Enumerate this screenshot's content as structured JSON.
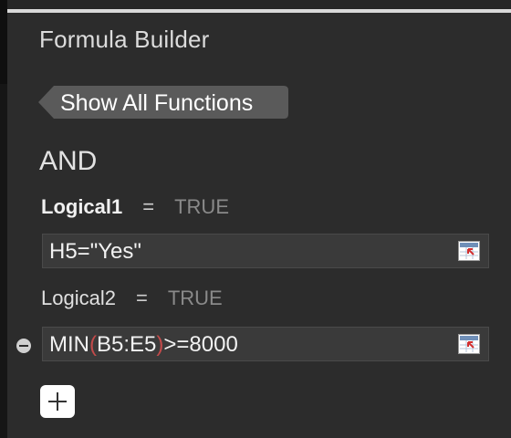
{
  "panel": {
    "title": "Formula Builder",
    "back_button_label": "Show All Functions",
    "function_name": "AND"
  },
  "arguments": [
    {
      "name": "Logical1",
      "equals": "=",
      "result": "TRUE",
      "value": "H5=\"Yes\""
    },
    {
      "name": "Logical2",
      "equals": "=",
      "result": "TRUE",
      "value_parts": {
        "prefix": "MIN",
        "open_paren": "(",
        "range": "B5:E5",
        "close_paren": ")",
        "suffix": ">=8000"
      }
    }
  ],
  "icons": {
    "reference": "cell-reference-icon",
    "remove": "minus-circle-icon",
    "add": "plus-icon"
  },
  "colors": {
    "background": "#2c2c2c",
    "field": "#3a3a3a",
    "paren_highlight": "#c34a4a",
    "result_text": "#8a8a8a"
  }
}
